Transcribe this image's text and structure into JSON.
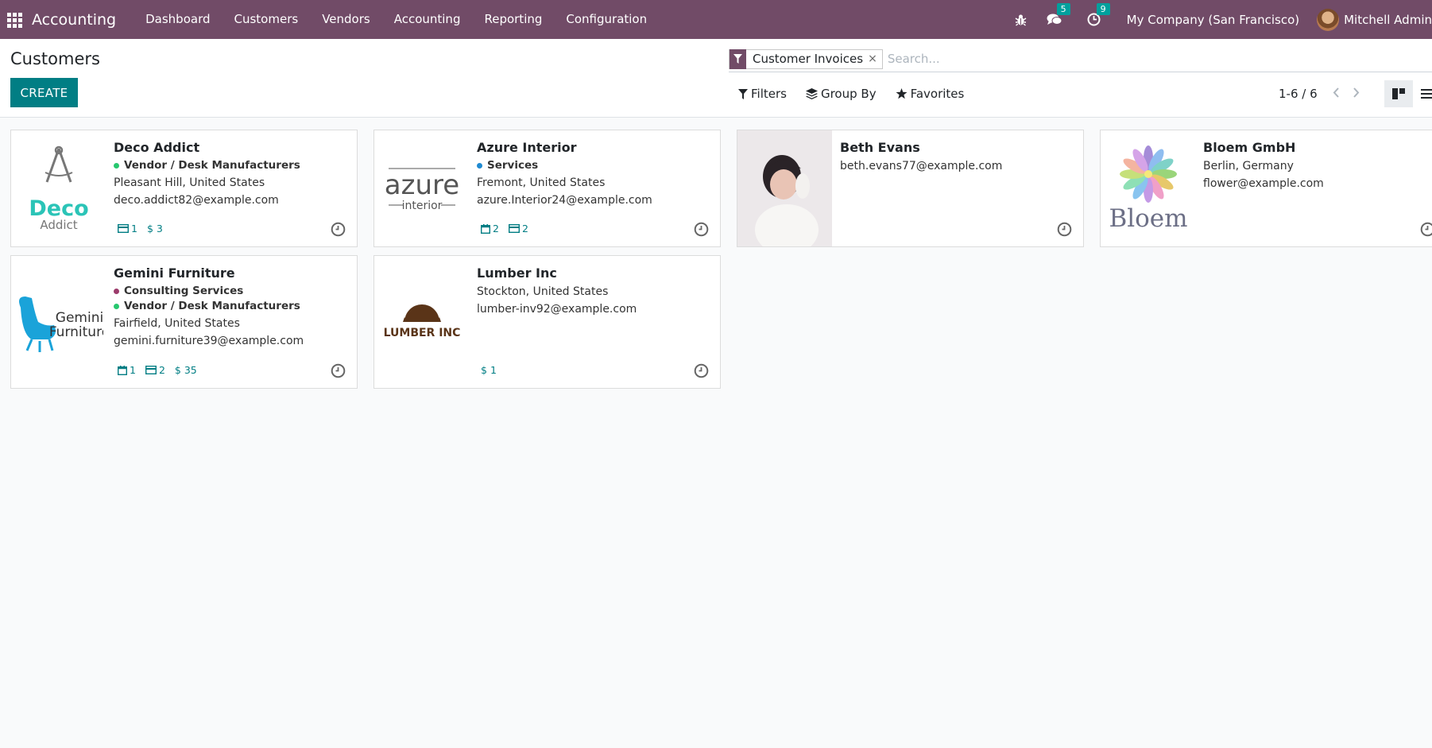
{
  "navbar": {
    "app_name": "Accounting",
    "menu": [
      "Dashboard",
      "Customers",
      "Vendors",
      "Accounting",
      "Reporting",
      "Configuration"
    ],
    "messages_badge": "5",
    "activities_badge": "9",
    "company": "My Company (San Francisco)",
    "user": "Mitchell Admin"
  },
  "control": {
    "title": "Customers",
    "create_label": "CREATE",
    "facet_label": "Customer Invoices",
    "search_placeholder": "Search...",
    "filters_label": "Filters",
    "groupby_label": "Group By",
    "favorites_label": "Favorites",
    "pager": "1-6 / 6"
  },
  "cards": [
    {
      "name": "Deco Addict",
      "tags": [
        {
          "label": "Vendor / Desk Manufacturers",
          "color": "#28c76f"
        }
      ],
      "lines": [
        "Pleasant Hill, United States",
        "deco.addict82@example.com"
      ],
      "logo_text": [
        "Deco",
        "Addict"
      ],
      "counters": [
        {
          "icon": "card-icon",
          "value": "1"
        },
        {
          "icon": "dollar-icon",
          "value": "3"
        }
      ]
    },
    {
      "name": "Azure Interior",
      "tags": [
        {
          "label": "Services",
          "color": "#1f8ad1"
        }
      ],
      "lines": [
        "Fremont, United States",
        "azure.Interior24@example.com"
      ],
      "logo_text": [
        "azure",
        "interior"
      ],
      "counters": [
        {
          "icon": "calendar-icon",
          "value": "2"
        },
        {
          "icon": "card-icon",
          "value": "2"
        }
      ]
    },
    {
      "name": "Beth Evans",
      "tags": [],
      "lines": [
        "beth.evans77@example.com"
      ],
      "logo_text": [],
      "counters": []
    },
    {
      "name": "Bloem GmbH",
      "tags": [],
      "lines": [
        "Berlin, Germany",
        "flower@example.com"
      ],
      "logo_text": [
        "Bloem"
      ],
      "counters": []
    },
    {
      "name": "Gemini Furniture",
      "tags": [
        {
          "label": "Consulting Services",
          "color": "#9c3b6b"
        },
        {
          "label": "Vendor / Desk Manufacturers",
          "color": "#28c76f"
        }
      ],
      "lines": [
        "Fairfield, United States",
        "gemini.furniture39@example.com"
      ],
      "logo_text": [
        "Gemini",
        "Furniture"
      ],
      "counters": [
        {
          "icon": "calendar-icon",
          "value": "1"
        },
        {
          "icon": "card-icon",
          "value": "2"
        },
        {
          "icon": "dollar-icon",
          "value": "35"
        }
      ]
    },
    {
      "name": "Lumber Inc",
      "tags": [],
      "lines": [
        "Stockton, United States",
        "lumber-inv92@example.com"
      ],
      "logo_text": [
        "LUMBER INC"
      ],
      "counters": [
        {
          "icon": "dollar-icon",
          "value": "1"
        }
      ]
    }
  ],
  "colors": {
    "brand": "#714b67",
    "accent": "#017e84"
  }
}
